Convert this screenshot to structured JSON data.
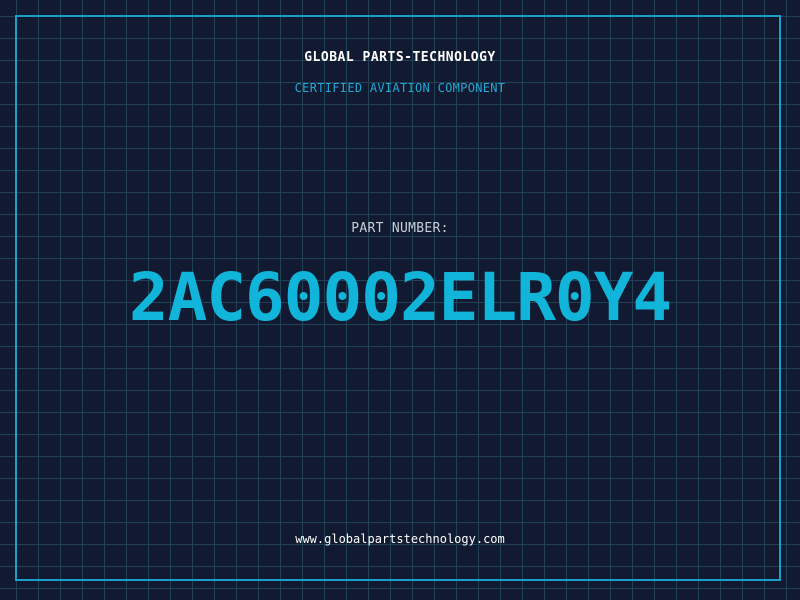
{
  "header": {
    "company": "GLOBAL PARTS-TECHNOLOGY",
    "subtitle": "CERTIFIED AVIATION COMPONENT"
  },
  "part": {
    "label": "PART NUMBER:",
    "number": "2AC60002ELR0Y4"
  },
  "footer": {
    "url": "www.globalpartstechnology.com"
  },
  "colors": {
    "background": "#111a30",
    "grid": "#1f4257",
    "frame": "#1aa0c8",
    "accent": "#11b5d9",
    "subtitle": "#22a7d6",
    "label": "#c8cfd8"
  }
}
